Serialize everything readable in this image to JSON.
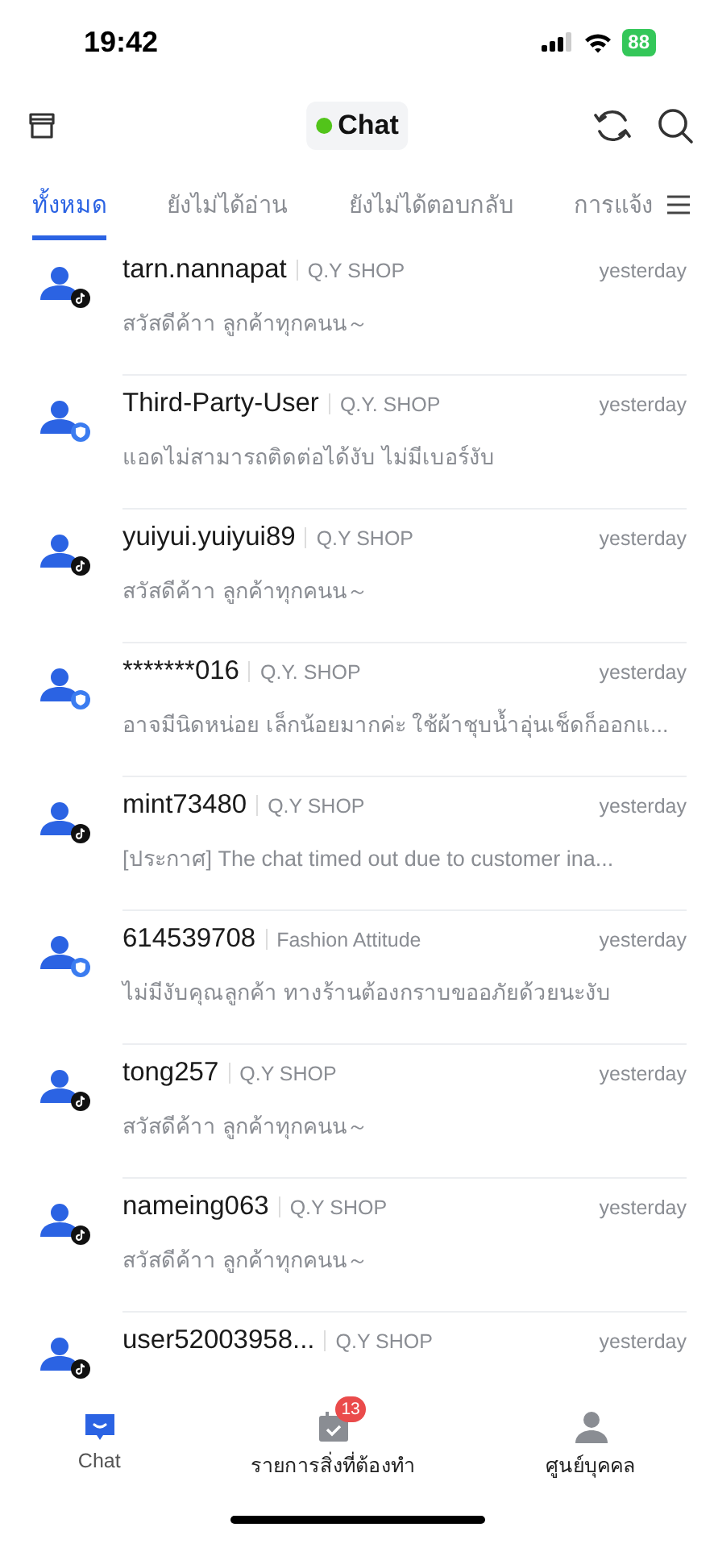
{
  "status_bar": {
    "time": "19:42",
    "battery": "88"
  },
  "header": {
    "title": "Chat",
    "online": true
  },
  "tabs": [
    {
      "label": "ทั้งหมด",
      "selected": true
    },
    {
      "label": "ยังไม่ได้อ่าน",
      "selected": false
    },
    {
      "label": "ยังไม่ได้ตอบกลับ",
      "selected": false
    },
    {
      "label": "การแจ้ง",
      "selected": false
    }
  ],
  "chats": [
    {
      "name": "tarn.nannapat",
      "shop": "Q.Y SHOP",
      "time": "yesterday",
      "preview": "สวัสดีค้าา ลูกค้าทุกคนน～",
      "kind": "note"
    },
    {
      "name": "Third-Party-User",
      "shop": "Q.Y. SHOP",
      "time": "yesterday",
      "preview": "แอดไม่สามารถติดต่อได้งับ ไม่มีเบอร์งับ",
      "kind": "shield"
    },
    {
      "name": "yuiyui.yuiyui89",
      "shop": "Q.Y SHOP",
      "time": "yesterday",
      "preview": "สวัสดีค้าา ลูกค้าทุกคนน～",
      "kind": "note"
    },
    {
      "name": "*******016",
      "shop": "Q.Y. SHOP",
      "time": "yesterday",
      "preview": "อาจมีนิดหน่อย เล็กน้อยมากค่ะ ใช้ผ้าชุบน้ำอุ่นเช็ดก็ออกแ...",
      "kind": "shield"
    },
    {
      "name": "mint73480",
      "shop": "Q.Y SHOP",
      "time": "yesterday",
      "preview": "[ประกาศ] The chat timed out due to customer ina...",
      "kind": "note"
    },
    {
      "name": "614539708",
      "shop": "Fashion Attitude",
      "time": "yesterday",
      "preview": "ไม่มีงับคุณลูกค้า ทางร้านต้องกราบขออภัยด้วยนะงับ",
      "kind": "shield"
    },
    {
      "name": "tong257",
      "shop": "Q.Y SHOP",
      "time": "yesterday",
      "preview": "สวัสดีค้าา ลูกค้าทุกคนน～",
      "kind": "note"
    },
    {
      "name": "nameing063",
      "shop": "Q.Y SHOP",
      "time": "yesterday",
      "preview": "สวัสดีค้าา ลูกค้าทุกคนน～",
      "kind": "note"
    },
    {
      "name": "user52003958...",
      "shop": "Q.Y SHOP",
      "time": "yesterday",
      "kind": "note"
    }
  ],
  "bottom_nav": [
    {
      "label": "Chat",
      "selected": true,
      "kind": "chat"
    },
    {
      "label": "รายการสิ่งที่ต้องทำ",
      "selected": false,
      "kind": "todo",
      "count": "13"
    },
    {
      "label": "ศูนย์บุคคล",
      "selected": false,
      "kind": "person"
    }
  ]
}
